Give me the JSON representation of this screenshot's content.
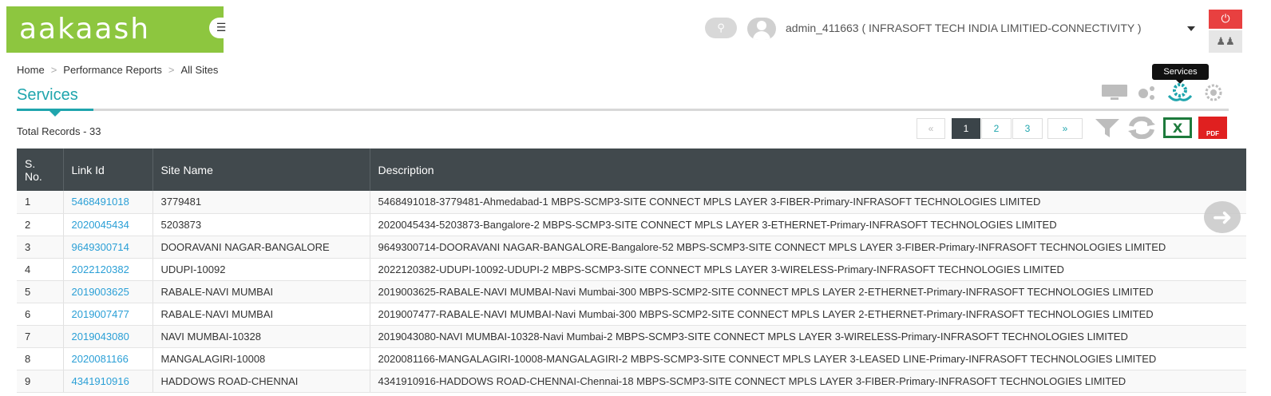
{
  "header": {
    "logo_text": "aakaash",
    "menu_icon": "hamburger-icon",
    "search_icon": "search-icon",
    "user_label": "admin_411663 ( INFRASOFT TECH INDIA LIMITIED-CONNECTIVITY )",
    "power_icon": "power-icon",
    "team_icon": "users-icon",
    "accent_color": "#8dc63f",
    "power_color": "#e84040"
  },
  "breadcrumb": {
    "items": [
      "Home",
      "Performance Reports",
      "All Sites"
    ],
    "separator": ">"
  },
  "page": {
    "title": "Services",
    "title_color": "#1fa5ad",
    "tooltip": "Services",
    "total_records": "Total Records - 33"
  },
  "view_icons": [
    "monitor-icon",
    "network-nodes-icon",
    "services-icon",
    "settings-cog-icon"
  ],
  "pagination": {
    "prev": "«",
    "pages": [
      "1",
      "2",
      "3"
    ],
    "next": "»",
    "current": "1"
  },
  "tools": {
    "filter_icon": "filter-icon",
    "refresh_icon": "refresh-icon",
    "excel_label": "X",
    "pdf_label": "PDF"
  },
  "table": {
    "columns": [
      "S. No.",
      "Link Id",
      "Site Name",
      "Description"
    ],
    "rows": [
      [
        "1",
        "5468491018",
        "3779481",
        "5468491018-3779481-Ahmedabad-1 MBPS-SCMP3-SITE CONNECT MPLS LAYER 3-FIBER-Primary-INFRASOFT TECHNOLOGIES LIMITED"
      ],
      [
        "2",
        "2020045434",
        "5203873",
        "2020045434-5203873-Bangalore-2 MBPS-SCMP3-SITE CONNECT MPLS LAYER 3-ETHERNET-Primary-INFRASOFT TECHNOLOGIES LIMITED"
      ],
      [
        "3",
        "9649300714",
        "DOORAVANI NAGAR-BANGALORE",
        "9649300714-DOORAVANI NAGAR-BANGALORE-Bangalore-52 MBPS-SCMP3-SITE CONNECT MPLS LAYER 3-FIBER-Primary-INFRASOFT TECHNOLOGIES LIMITED"
      ],
      [
        "4",
        "2022120382",
        "UDUPI-10092",
        "2022120382-UDUPI-10092-UDUPI-2 MBPS-SCMP3-SITE CONNECT MPLS LAYER 3-WIRELESS-Primary-INFRASOFT TECHNOLOGIES LIMITED"
      ],
      [
        "5",
        "2019003625",
        "RABALE-NAVI MUMBAI",
        "2019003625-RABALE-NAVI MUMBAI-Navi Mumbai-300 MBPS-SCMP2-SITE CONNECT MPLS LAYER 2-ETHERNET-Primary-INFRASOFT TECHNOLOGIES LIMITED"
      ],
      [
        "6",
        "2019007477",
        "RABALE-NAVI MUMBAI",
        "2019007477-RABALE-NAVI MUMBAI-Navi Mumbai-300 MBPS-SCMP2-SITE CONNECT MPLS LAYER 2-ETHERNET-Primary-INFRASOFT TECHNOLOGIES LIMITED"
      ],
      [
        "7",
        "2019043080",
        "NAVI MUMBAI-10328",
        "2019043080-NAVI MUMBAI-10328-Navi Mumbai-2 MBPS-SCMP3-SITE CONNECT MPLS LAYER 3-WIRELESS-Primary-INFRASOFT TECHNOLOGIES LIMITED"
      ],
      [
        "8",
        "2020081166",
        "MANGALAGIRI-10008",
        "2020081166-MANGALAGIRI-10008-MANGALAGIRI-2 MBPS-SCMP3-SITE CONNECT MPLS LAYER 3-LEASED LINE-Primary-INFRASOFT TECHNOLOGIES LIMITED"
      ],
      [
        "9",
        "4341910916",
        "HADDOWS ROAD-CHENNAI",
        "4341910916-HADDOWS ROAD-CHENNAI-Chennai-18 MBPS-SCMP3-SITE CONNECT MPLS LAYER 3-FIBER-Primary-INFRASOFT TECHNOLOGIES LIMITED"
      ]
    ]
  },
  "scroll_next_icon": "arrow-right-circle-icon"
}
